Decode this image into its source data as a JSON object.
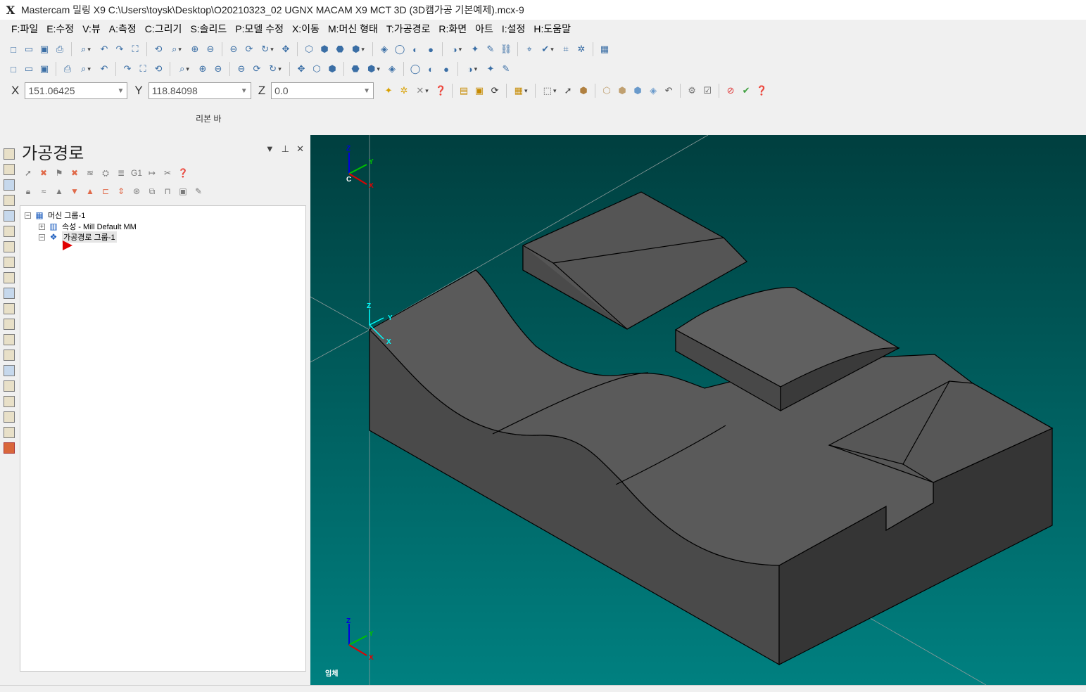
{
  "window": {
    "title": "Mastercam 밀링 X9  C:\\Users\\toysk\\Desktop\\O20210323_02 UGNX MACAM X9 MCT 3D (3D캠가공 기본예제).mcx-9",
    "logo": "X"
  },
  "menu": [
    "F:파일",
    "E:수정",
    "V:뷰",
    "A:측정",
    "C:그리기",
    "S:솔리드",
    "P:모델 수정",
    "X:이동",
    "M:머신 형태",
    "T:가공경로",
    "R:화면",
    "아트",
    "I:설정",
    "H:도움말"
  ],
  "coords": {
    "x_label": "X",
    "x_value": "151.06425",
    "y_label": "Y",
    "y_value": "118.84098",
    "z_label": "Z",
    "z_value": "0.0"
  },
  "ribbon_label": "리본 바",
  "panel": {
    "title": "가공경로",
    "tree": {
      "machine_group": "머신 그룹-1",
      "properties": "속성 - Mill Default MM",
      "toolpath_group": "가공경로 그룹-1"
    }
  },
  "viewport": {
    "view_name": "임체",
    "axis_labels": {
      "z": "Z",
      "y": "Y",
      "x": "X",
      "c": "C"
    },
    "colors": {
      "background_top": "#003f3f",
      "background_bottom": "#008080",
      "solid_top": "#5a5a5a",
      "solid_side": "#3f3f3f",
      "axis_x": "#e00000",
      "axis_y": "#00c000",
      "axis_z": "#0000e0",
      "axis_origin": "#00ffff"
    }
  },
  "icons": {
    "toolbar1": [
      "new-file-icon",
      "open-file-icon",
      "save-icon",
      "print-icon",
      "print-preview-icon",
      "undo-icon",
      "redo-icon",
      "fit-icon",
      "repaint-icon",
      "zoom-window-icon",
      "zoom-target-icon",
      "unzoom-icon",
      "zoom-out-icon",
      "rotate-icon",
      "dynamic-rotate-icon",
      "pan-icon",
      "view-top-icon",
      "view-front-icon",
      "view-right-icon",
      "view-iso-icon",
      "shading-icon",
      "sphere-icon",
      "wire-icon",
      "shade-icon",
      "translucent-icon",
      "hide-icon",
      "pencil-icon",
      "chain-icon",
      "analyze-icon",
      "check-icon",
      "graph-icon",
      "plugin-icon",
      "grid-icon"
    ],
    "toolbar2": [
      "point-icon",
      "line-icon",
      "circle-icon",
      "rectangle-icon",
      "arc-icon",
      "spline-icon",
      "cylinder-icon",
      "surface-icon",
      "trim-icon",
      "delete-icon",
      "break-icon",
      "join-icon",
      "offset-icon",
      "mirror-icon",
      "scale-icon",
      "rotate-entity-icon",
      "array-icon",
      "translate-icon",
      "solid-icon",
      "fillet-icon",
      "dimension-icon",
      "note-icon",
      "hatch-icon",
      "toolpath-icon",
      "backplot-icon",
      "verify-icon",
      "simulate-icon"
    ]
  }
}
